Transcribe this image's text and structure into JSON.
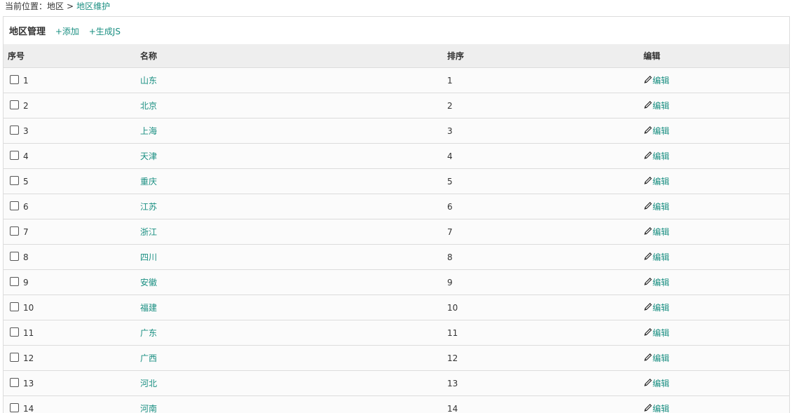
{
  "breadcrumb": {
    "prefix": "当前位置：",
    "parent": "地区",
    "separator": ">",
    "current": "地区维护"
  },
  "panel": {
    "title": "地区管理",
    "add_link": "+添加",
    "gen_js_link": "+生成JS"
  },
  "table": {
    "columns": [
      "序号",
      "名称",
      "排序",
      "编辑"
    ],
    "edit_label": "编辑",
    "rows": [
      {
        "id": "1",
        "name": "山东",
        "order": "1"
      },
      {
        "id": "2",
        "name": "北京",
        "order": "2"
      },
      {
        "id": "3",
        "name": "上海",
        "order": "3"
      },
      {
        "id": "4",
        "name": "天津",
        "order": "4"
      },
      {
        "id": "5",
        "name": "重庆",
        "order": "5"
      },
      {
        "id": "6",
        "name": "江苏",
        "order": "6"
      },
      {
        "id": "7",
        "name": "浙江",
        "order": "7"
      },
      {
        "id": "8",
        "name": "四川",
        "order": "8"
      },
      {
        "id": "9",
        "name": "安徽",
        "order": "9"
      },
      {
        "id": "10",
        "name": "福建",
        "order": "10"
      },
      {
        "id": "11",
        "name": "广东",
        "order": "11"
      },
      {
        "id": "12",
        "name": "广西",
        "order": "12"
      },
      {
        "id": "13",
        "name": "河北",
        "order": "13"
      },
      {
        "id": "14",
        "name": "河南",
        "order": "14"
      }
    ]
  },
  "colors": {
    "link": "#1a8f82",
    "header_bg": "#eeeeee",
    "row_bg": "#fbfbfb",
    "border": "#dcdcdc"
  },
  "icons": {
    "edit": "pencil-icon",
    "select": "checkbox"
  }
}
